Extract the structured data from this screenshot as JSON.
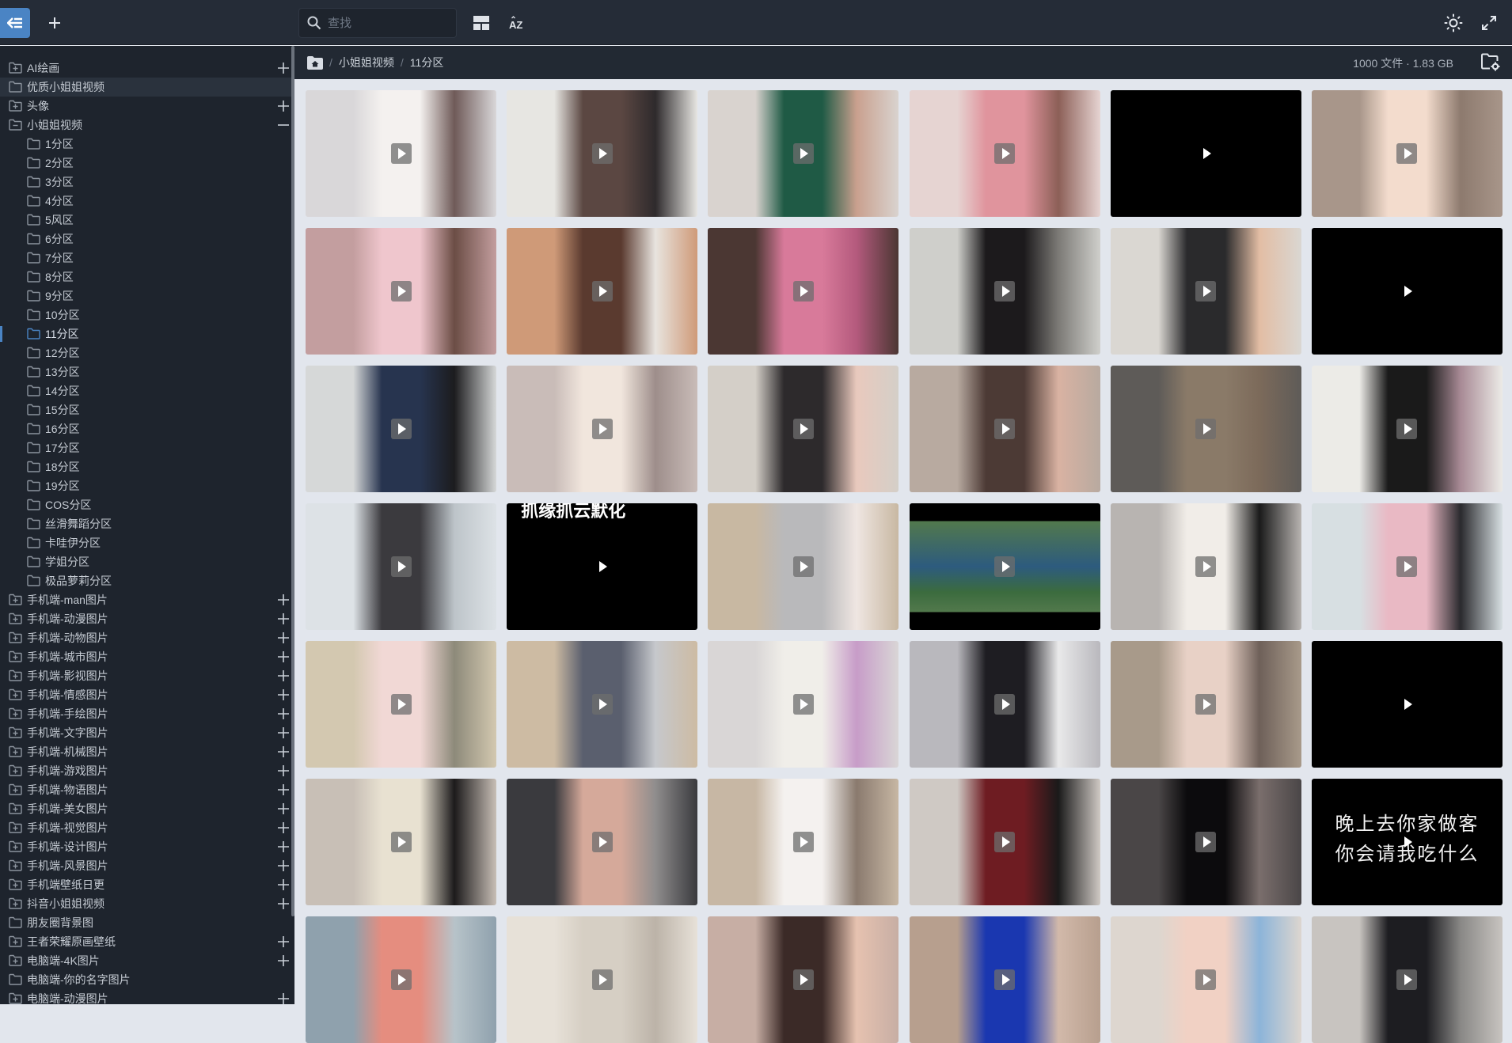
{
  "toolbar": {
    "back_icon": "collapse-sidebar-icon",
    "add_icon": "plus-icon",
    "search_placeholder": "查找",
    "search_value": "",
    "layout_icon": "layout-grid-icon",
    "sort_icon": "sort-az-icon",
    "theme_icon": "sun-icon",
    "fullscreen_icon": "expand-icon"
  },
  "breadcrumb": {
    "home_icon": "home-folder-icon",
    "items": [
      "小姐姐视频",
      "11分区"
    ],
    "separator": "/"
  },
  "summary": {
    "text": "1000 文件 · 1.83 GB",
    "settings_icon": "folder-settings-icon"
  },
  "accent_color": "#4a84c4",
  "sidebar": {
    "items": [
      {
        "label": "AI绘画",
        "level": 0,
        "expandable": true,
        "state": "collapsed"
      },
      {
        "label": "优质小姐姐视频",
        "level": 0,
        "expandable": false,
        "hover": true
      },
      {
        "label": "头像",
        "level": 0,
        "expandable": true,
        "state": "collapsed"
      },
      {
        "label": "小姐姐视频",
        "level": 0,
        "expandable": true,
        "state": "expanded"
      },
      {
        "label": "1分区",
        "level": 1
      },
      {
        "label": "2分区",
        "level": 1
      },
      {
        "label": "3分区",
        "level": 1
      },
      {
        "label": "4分区",
        "level": 1
      },
      {
        "label": "5风区",
        "level": 1
      },
      {
        "label": "6分区",
        "level": 1
      },
      {
        "label": "7分区",
        "level": 1
      },
      {
        "label": "8分区",
        "level": 1
      },
      {
        "label": "9分区",
        "level": 1
      },
      {
        "label": "10分区",
        "level": 1
      },
      {
        "label": "11分区",
        "level": 1,
        "selected": true
      },
      {
        "label": "12分区",
        "level": 1
      },
      {
        "label": "13分区",
        "level": 1
      },
      {
        "label": "14分区",
        "level": 1
      },
      {
        "label": "15分区",
        "level": 1
      },
      {
        "label": "16分区",
        "level": 1
      },
      {
        "label": "17分区",
        "level": 1
      },
      {
        "label": "18分区",
        "level": 1
      },
      {
        "label": "19分区",
        "level": 1
      },
      {
        "label": "COS分区",
        "level": 1
      },
      {
        "label": "丝滑舞蹈分区",
        "level": 1
      },
      {
        "label": "卡哇伊分区",
        "level": 1
      },
      {
        "label": "学姐分区",
        "level": 1
      },
      {
        "label": "极品萝莉分区",
        "level": 1
      },
      {
        "label": "手机端-man图片",
        "level": 0,
        "expandable": true,
        "state": "collapsed"
      },
      {
        "label": "手机端-动漫图片",
        "level": 0,
        "expandable": true,
        "state": "collapsed"
      },
      {
        "label": "手机端-动物图片",
        "level": 0,
        "expandable": true,
        "state": "collapsed"
      },
      {
        "label": "手机端-城市图片",
        "level": 0,
        "expandable": true,
        "state": "collapsed"
      },
      {
        "label": "手机端-影视图片",
        "level": 0,
        "expandable": true,
        "state": "collapsed"
      },
      {
        "label": "手机端-情感图片",
        "level": 0,
        "expandable": true,
        "state": "collapsed"
      },
      {
        "label": "手机端-手绘图片",
        "level": 0,
        "expandable": true,
        "state": "collapsed"
      },
      {
        "label": "手机端-文字图片",
        "level": 0,
        "expandable": true,
        "state": "collapsed"
      },
      {
        "label": "手机端-机械图片",
        "level": 0,
        "expandable": true,
        "state": "collapsed"
      },
      {
        "label": "手机端-游戏图片",
        "level": 0,
        "expandable": true,
        "state": "collapsed"
      },
      {
        "label": "手机端-物语图片",
        "level": 0,
        "expandable": true,
        "state": "collapsed"
      },
      {
        "label": "手机端-美女图片",
        "level": 0,
        "expandable": true,
        "state": "collapsed"
      },
      {
        "label": "手机端-视觉图片",
        "level": 0,
        "expandable": true,
        "state": "collapsed"
      },
      {
        "label": "手机端-设计图片",
        "level": 0,
        "expandable": true,
        "state": "collapsed"
      },
      {
        "label": "手机端-风景图片",
        "level": 0,
        "expandable": true,
        "state": "collapsed"
      },
      {
        "label": "手机端壁纸日更",
        "level": 0,
        "expandable": true,
        "state": "collapsed"
      },
      {
        "label": "抖音小姐姐视频",
        "level": 0,
        "expandable": true,
        "state": "collapsed"
      },
      {
        "label": "朋友圈背景图",
        "level": 0,
        "expandable": false
      },
      {
        "label": "王者荣耀原画壁纸",
        "level": 0,
        "expandable": true,
        "state": "collapsed"
      },
      {
        "label": "电脑端-4K图片",
        "level": 0,
        "expandable": true,
        "state": "collapsed"
      },
      {
        "label": "电脑端-你的名字图片",
        "level": 0,
        "expandable": false
      },
      {
        "label": "电脑端-动漫图片",
        "level": 0,
        "expandable": true,
        "state": "collapsed"
      }
    ]
  },
  "grid": {
    "items": [
      {
        "type": "video",
        "colors": [
          "#d9d7d9",
          "#f4f1ef",
          "#6f5a58"
        ]
      },
      {
        "type": "video",
        "colors": [
          "#e7e6e2",
          "#5b4742",
          "#2e2a2c"
        ]
      },
      {
        "type": "video",
        "colors": [
          "#d9d3cf",
          "#1f5a45",
          "#c9a08e"
        ]
      },
      {
        "type": "video",
        "colors": [
          "#e6d4d2",
          "#e0949d",
          "#8c5f57"
        ]
      },
      {
        "type": "video",
        "colors": [
          "#000000",
          "#000000",
          "#000000"
        ],
        "black": true
      },
      {
        "type": "video",
        "colors": [
          "#a8968a",
          "#f3dccd",
          "#8d7a6e"
        ]
      },
      {
        "type": "video",
        "colors": [
          "#c39e9f",
          "#efc6cd",
          "#6b4d45"
        ]
      },
      {
        "type": "video",
        "colors": [
          "#cf9a78",
          "#5a3a2f",
          "#e8e4df"
        ]
      },
      {
        "type": "video",
        "colors": [
          "#4b3733",
          "#d87a9a",
          "#b45a7d"
        ]
      },
      {
        "type": "video",
        "colors": [
          "#cfcfcb",
          "#1c1a1c",
          "#7c7a76"
        ]
      },
      {
        "type": "video",
        "colors": [
          "#dad7d2",
          "#2a2a2c",
          "#e2bda4"
        ]
      },
      {
        "type": "video",
        "colors": [
          "#000000",
          "#000000",
          "#000000"
        ],
        "black": true
      },
      {
        "type": "video",
        "colors": [
          "#d6d8d8",
          "#27344f",
          "#1c1c1e"
        ]
      },
      {
        "type": "video",
        "colors": [
          "#c9bcb8",
          "#f1e6dd",
          "#9e8e8b"
        ]
      },
      {
        "type": "video",
        "colors": [
          "#d4cfc8",
          "#2d2a2c",
          "#e9c9bd"
        ]
      },
      {
        "type": "video",
        "colors": [
          "#b8aaa0",
          "#4c3a35",
          "#d9b2a2"
        ]
      },
      {
        "type": "video",
        "colors": [
          "#5e5b58",
          "#8a7a68",
          "#7c6a5a"
        ]
      },
      {
        "type": "video",
        "colors": [
          "#ecebe7",
          "#1a1a1a",
          "#a88a95"
        ]
      },
      {
        "type": "video",
        "colors": [
          "#dde2e6",
          "#3b3a3e",
          "#bdc4c9"
        ]
      },
      {
        "type": "video",
        "colors": [
          "#000000",
          "#000000",
          "#000000"
        ],
        "black": true,
        "top_caption": "抓缘抓云默化"
      },
      {
        "type": "video",
        "colors": [
          "#c8b8a2",
          "#b9b9bb",
          "#efe6e2"
        ]
      },
      {
        "type": "video",
        "colors": [
          "#000000",
          "#52794c",
          "#2d5b7e"
        ],
        "game": true
      },
      {
        "type": "video",
        "colors": [
          "#b8b4b1",
          "#f1ede8",
          "#1a1a1a"
        ]
      },
      {
        "type": "video",
        "colors": [
          "#d7dfe2",
          "#e9b9c4",
          "#2a2a2e"
        ]
      },
      {
        "type": "video",
        "colors": [
          "#d3c8b0",
          "#f1d8d5",
          "#8d8a7a"
        ]
      },
      {
        "type": "video",
        "colors": [
          "#cdbba3",
          "#5a5f6e",
          "#c6c8cc"
        ]
      },
      {
        "type": "video",
        "colors": [
          "#d9d6d6",
          "#f0eee9",
          "#c79cc8"
        ]
      },
      {
        "type": "video",
        "colors": [
          "#b9b8bd",
          "#1e1d22",
          "#e9e9ea"
        ]
      },
      {
        "type": "video",
        "colors": [
          "#a89a8a",
          "#e8d1c6",
          "#6e6059"
        ]
      },
      {
        "type": "video",
        "colors": [
          "#000000",
          "#000000",
          "#000000"
        ],
        "black": true
      },
      {
        "type": "video",
        "colors": [
          "#c8bfb6",
          "#e8e1d1",
          "#1c1a1b"
        ]
      },
      {
        "type": "video",
        "colors": [
          "#3a3a3e",
          "#d5a99a",
          "#8f8d8d"
        ]
      },
      {
        "type": "video",
        "colors": [
          "#c7b7a4",
          "#f4f1ef",
          "#8a7a6e"
        ]
      },
      {
        "type": "video",
        "colors": [
          "#cfc9c4",
          "#6e1c22",
          "#1a1a1a"
        ]
      },
      {
        "type": "video",
        "colors": [
          "#4a4647",
          "#0c0b0d",
          "#7a6e6c"
        ]
      },
      {
        "type": "video",
        "colors": [
          "#000000",
          "#000000",
          "#000000"
        ],
        "black": true,
        "caption": [
          "晚上去你家做客",
          "你会请我吃什么"
        ]
      },
      {
        "type": "video",
        "colors": [
          "#8fa1ad",
          "#e58d7f",
          "#b7c3c9"
        ]
      },
      {
        "type": "video",
        "colors": [
          "#e7e1d8",
          "#d6cfc4",
          "#bcb3a8"
        ]
      },
      {
        "type": "video",
        "colors": [
          "#c7aea4",
          "#3b2a27",
          "#e6c2b0"
        ]
      },
      {
        "type": "video",
        "colors": [
          "#b79f8e",
          "#1a37b0",
          "#d2b9aa"
        ]
      },
      {
        "type": "video",
        "colors": [
          "#ddd6cf",
          "#f1d1c4",
          "#8cb4d9"
        ]
      },
      {
        "type": "video",
        "colors": [
          "#c8c4c0",
          "#1d1d21",
          "#898886"
        ]
      }
    ]
  }
}
